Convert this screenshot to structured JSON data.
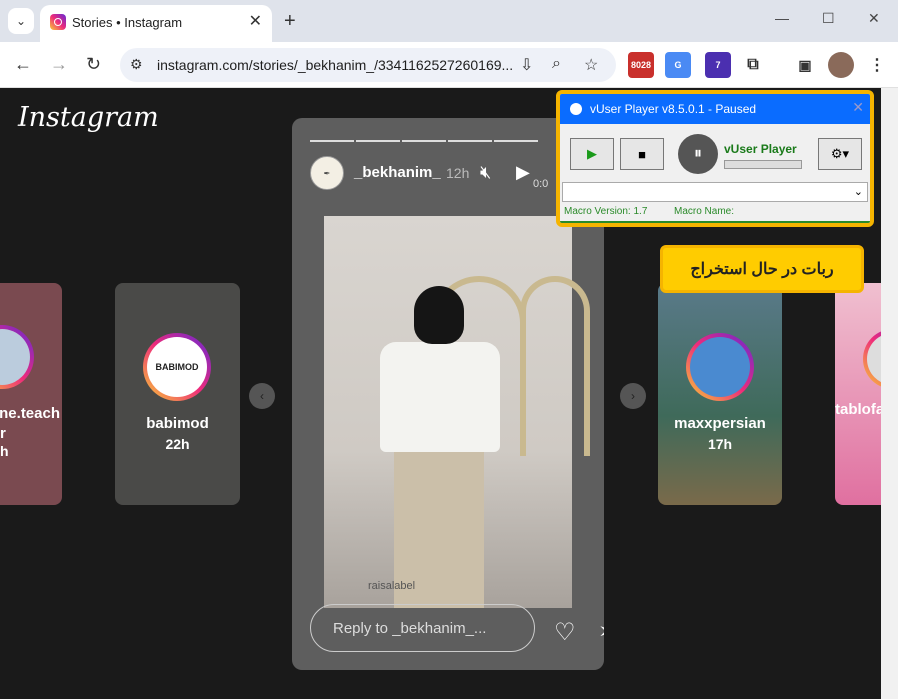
{
  "browser": {
    "tab_title": "Stories • Instagram",
    "url": "instagram.com/stories/_bekhanim_/3341162527260169...",
    "ext_gmail_badge": "8028",
    "ext_purple_badge": "7"
  },
  "page": {
    "logo": "Instagram",
    "left_story_1": {
      "name": "ne.teach",
      "name2": "r",
      "time": "h"
    },
    "left_story_2": {
      "name": "babimod",
      "time": "22h",
      "avatar_text": "BABIMOD"
    },
    "right_story_1": {
      "name": "maxxpersian",
      "time": "17h"
    },
    "right_story_2": {
      "name": "tablofa"
    },
    "main_story": {
      "user": "_bekhanim_",
      "time": "12h",
      "timer": "0:0",
      "watermark": "raisalabel",
      "reply_placeholder": "Reply to _bekhanim_...",
      "progress_segments": 5
    }
  },
  "vuser": {
    "title": "vUser Player v8.5.0.1 - Paused",
    "name": "vUser Player",
    "macro_version_label": "Macro Version: 1.7",
    "macro_name_label": "Macro Name:"
  },
  "callout": {
    "text": "ربات در حال استخراج"
  }
}
